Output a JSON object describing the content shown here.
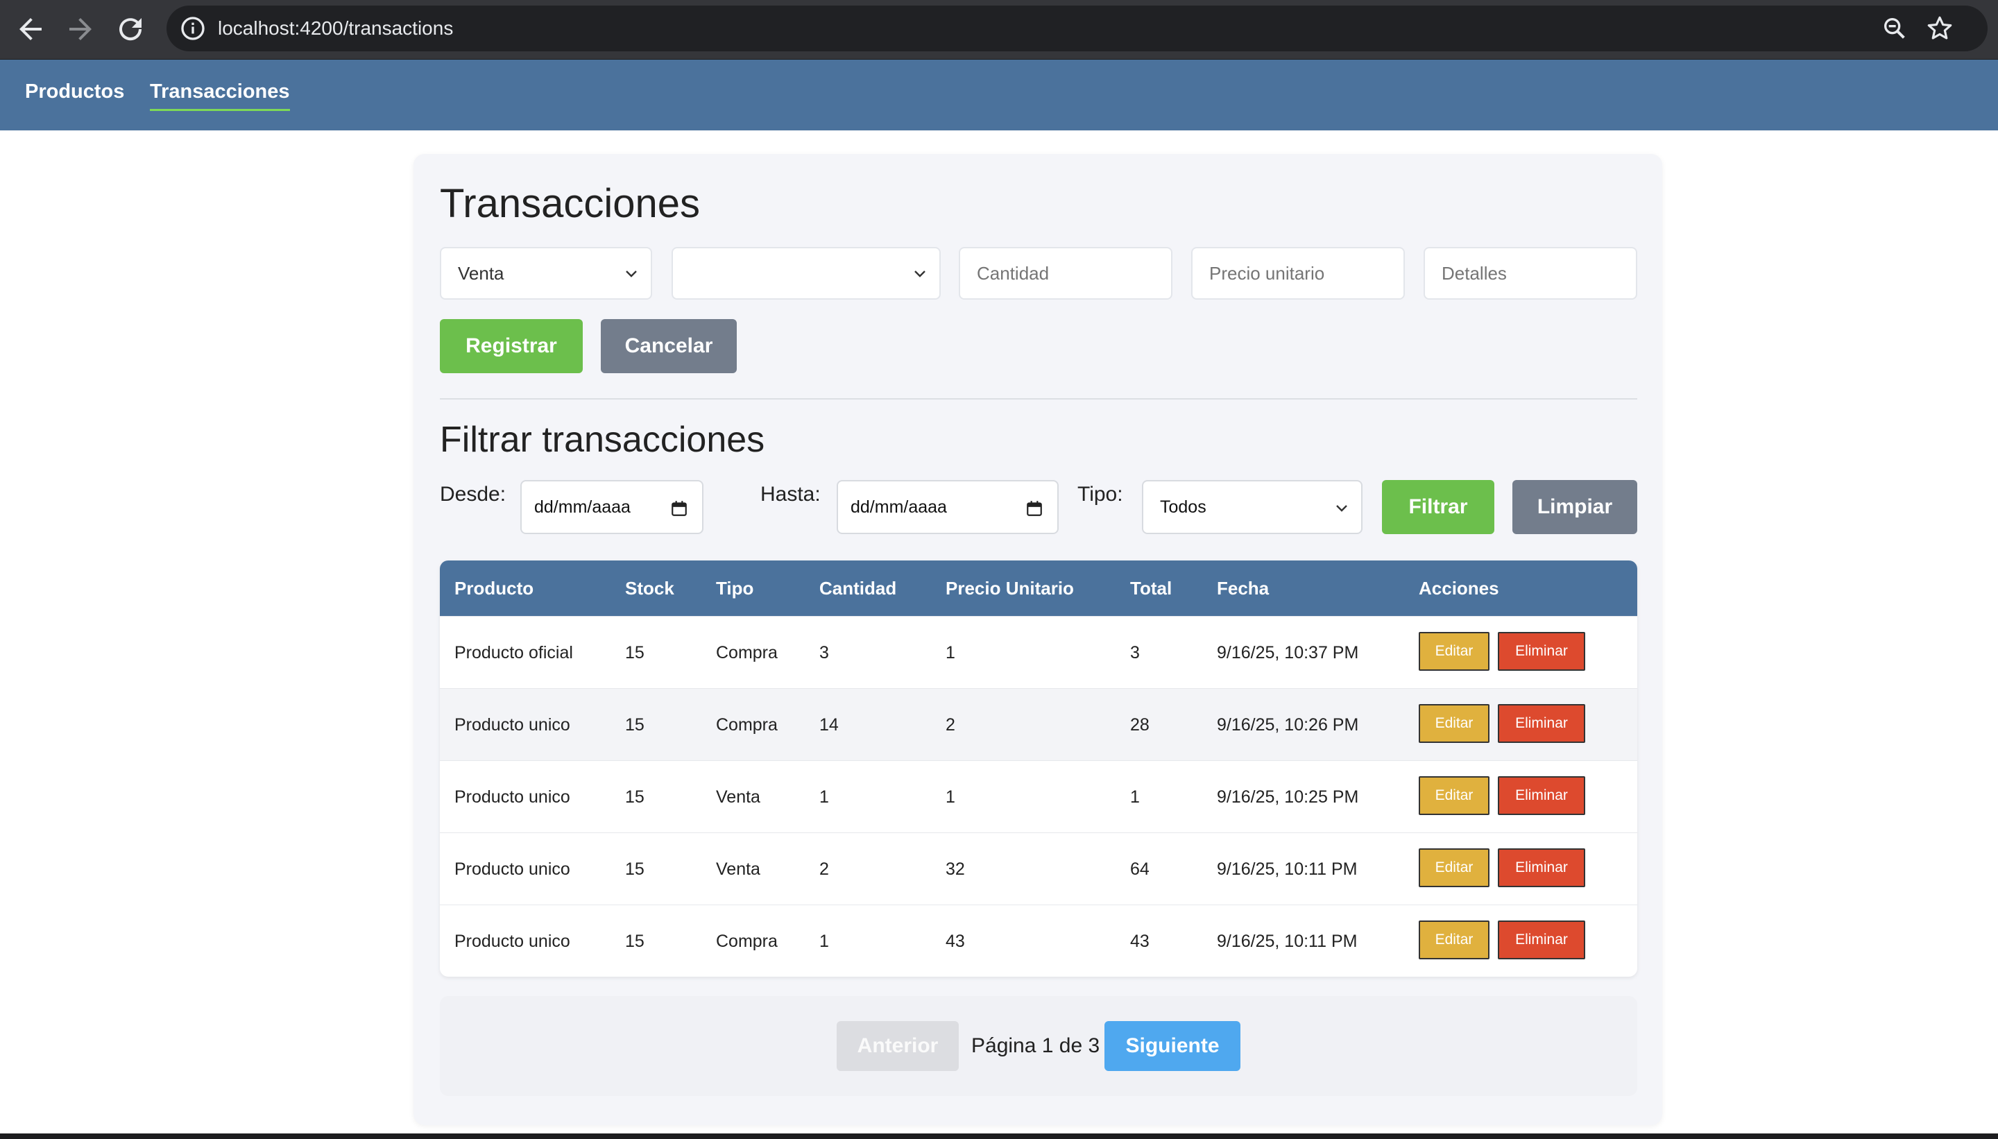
{
  "browser": {
    "url": "localhost:4200/transactions",
    "back_icon": "arrow-left-icon",
    "forward_icon": "arrow-right-icon",
    "reload_icon": "reload-icon"
  },
  "nav": {
    "items": [
      {
        "label": "Productos",
        "active": false
      },
      {
        "label": "Transacciones",
        "active": true
      }
    ]
  },
  "form": {
    "title": "Transacciones",
    "tipo_selected": "Venta",
    "producto_selected": "",
    "cantidad_placeholder": "Cantidad",
    "precio_placeholder": "Precio unitario",
    "detalles_placeholder": "Detalles",
    "register_label": "Registrar",
    "cancel_label": "Cancelar"
  },
  "filter": {
    "title": "Filtrar transacciones",
    "from_label": "Desde:",
    "from_value": "dd/mm/aaaa",
    "to_label": "Hasta:",
    "to_value": "dd/mm/aaaa",
    "type_label": "Tipo:",
    "type_selected": "Todos",
    "filter_label": "Filtrar",
    "clear_label": "Limpiar"
  },
  "table": {
    "headers": [
      "Producto",
      "Stock",
      "Tipo",
      "Cantidad",
      "Precio Unitario",
      "Total",
      "Fecha",
      "Acciones"
    ],
    "edit_label": "Editar",
    "delete_label": "Eliminar",
    "rows": [
      {
        "producto": "Producto oficial",
        "stock": "15",
        "tipo": "Compra",
        "cantidad": "3",
        "precio": "1",
        "total": "3",
        "fecha": "9/16/25, 10:37 PM"
      },
      {
        "producto": "Producto unico",
        "stock": "15",
        "tipo": "Compra",
        "cantidad": "14",
        "precio": "2",
        "total": "28",
        "fecha": "9/16/25, 10:26 PM"
      },
      {
        "producto": "Producto unico",
        "stock": "15",
        "tipo": "Venta",
        "cantidad": "1",
        "precio": "1",
        "total": "1",
        "fecha": "9/16/25, 10:25 PM"
      },
      {
        "producto": "Producto unico",
        "stock": "15",
        "tipo": "Venta",
        "cantidad": "2",
        "precio": "32",
        "total": "64",
        "fecha": "9/16/25, 10:11 PM"
      },
      {
        "producto": "Producto unico",
        "stock": "15",
        "tipo": "Compra",
        "cantidad": "1",
        "precio": "43",
        "total": "43",
        "fecha": "9/16/25, 10:11 PM"
      }
    ]
  },
  "pagination": {
    "prev_label": "Anterior",
    "info": "Página 1 de 3",
    "next_label": "Siguiente"
  },
  "colors": {
    "nav_bg": "#4b729c",
    "green": "#6cbf4c",
    "gray": "#737d8c",
    "edit": "#e0b13e",
    "delete": "#dd4a2e",
    "next": "#4fa8ef"
  }
}
